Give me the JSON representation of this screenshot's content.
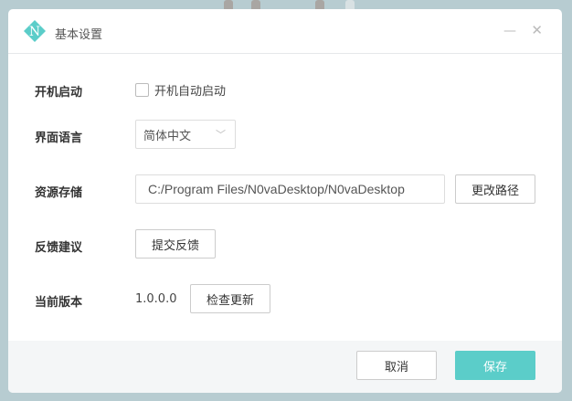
{
  "window": {
    "title": "基本设置",
    "logo_letter": "N",
    "accent": "#5bcdc9"
  },
  "settings": {
    "startup": {
      "label": "开机启动",
      "checkbox_label": "开机自动启动",
      "checked": false
    },
    "language": {
      "label": "界面语言",
      "value": "简体中文"
    },
    "storage": {
      "label": "资源存储",
      "path": "C:/Program Files/N0vaDesktop/N0vaDesktop",
      "change_button": "更改路径"
    },
    "feedback": {
      "label": "反馈建议",
      "button": "提交反馈"
    },
    "version": {
      "label": "当前版本",
      "value": "1.0.0.0",
      "button": "检查更新"
    }
  },
  "footer": {
    "cancel": "取消",
    "save": "保存"
  }
}
